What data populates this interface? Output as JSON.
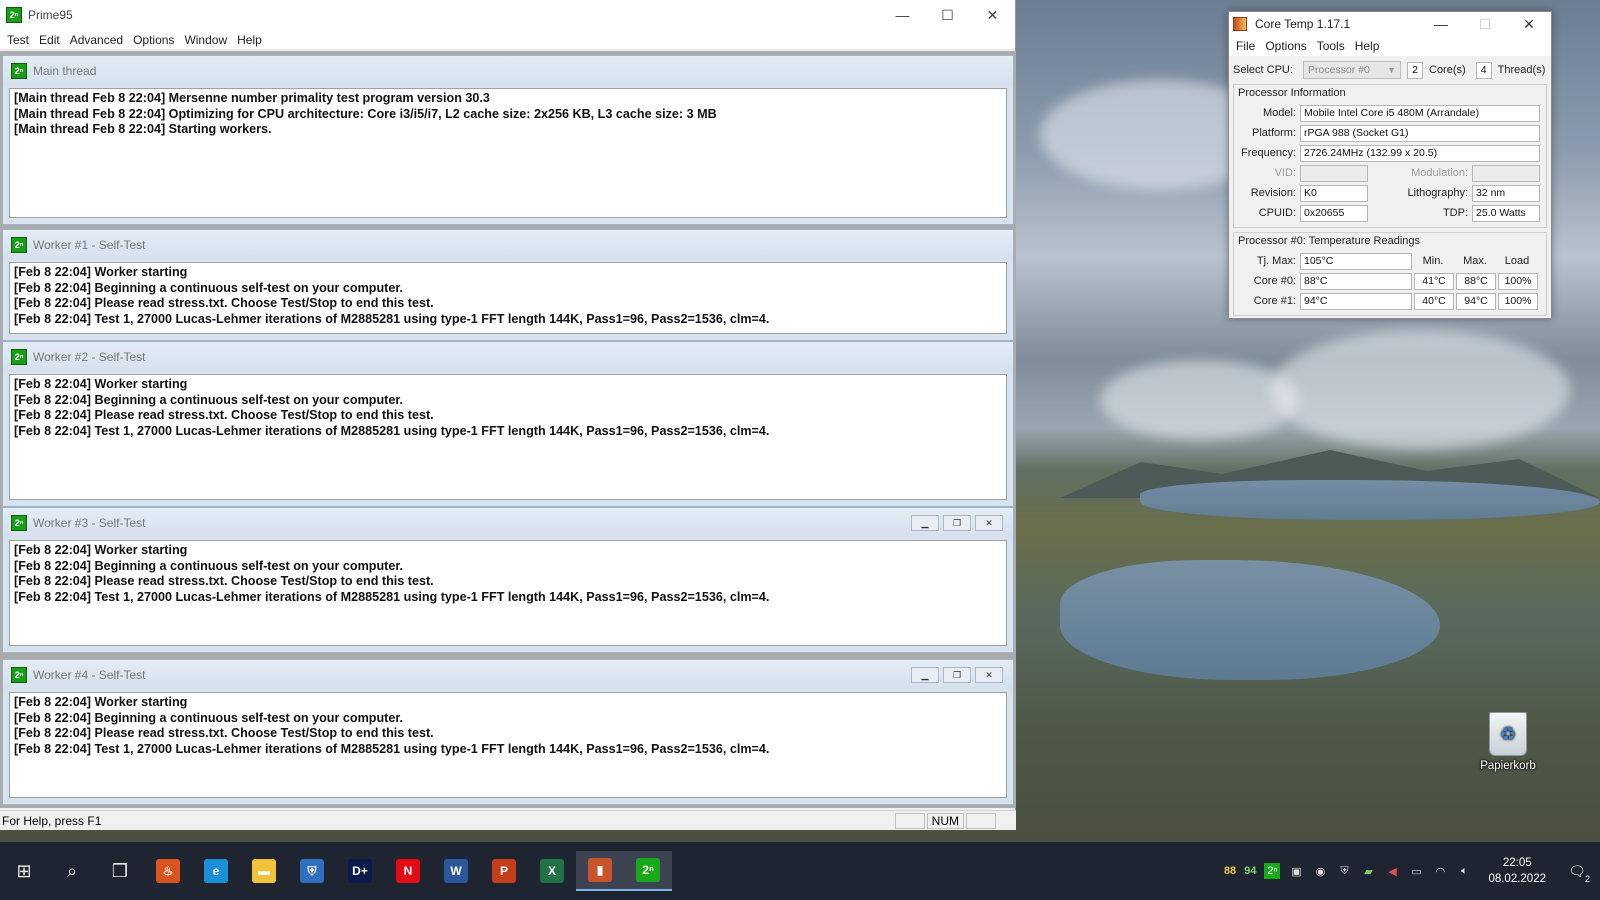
{
  "prime95": {
    "title": "Prime95",
    "menu": [
      "Test",
      "Edit",
      "Advanced",
      "Options",
      "Window",
      "Help"
    ],
    "windows": [
      {
        "title": "Main thread",
        "lines": [
          "[Main thread Feb 8 22:04] Mersenne number primality test program version 30.3",
          "[Main thread Feb 8 22:04] Optimizing for CPU architecture: Core i3/i5/i7, L2 cache size: 2x256 KB, L3 cache size: 3 MB",
          "[Main thread Feb 8 22:04] Starting workers."
        ]
      },
      {
        "title": "Worker #1 - Self-Test",
        "lines": [
          "[Feb 8 22:04] Worker starting",
          "[Feb 8 22:04] Beginning a continuous self-test on your computer.",
          "[Feb 8 22:04] Please read stress.txt.  Choose Test/Stop to end this test.",
          "[Feb 8 22:04] Test 1, 27000 Lucas-Lehmer iterations of M2885281 using type-1 FFT length 144K, Pass1=96, Pass2=1536, clm=4."
        ]
      },
      {
        "title": "Worker #2 - Self-Test",
        "lines": [
          "[Feb 8 22:04] Worker starting",
          "[Feb 8 22:04] Beginning a continuous self-test on your computer.",
          "[Feb 8 22:04] Please read stress.txt.  Choose Test/Stop to end this test.",
          "[Feb 8 22:04] Test 1, 27000 Lucas-Lehmer iterations of M2885281 using type-1 FFT length 144K, Pass1=96, Pass2=1536, clm=4."
        ]
      },
      {
        "title": "Worker #3 - Self-Test",
        "lines": [
          "[Feb 8 22:04] Worker starting",
          "[Feb 8 22:04] Beginning a continuous self-test on your computer.",
          "[Feb 8 22:04] Please read stress.txt.  Choose Test/Stop to end this test.",
          "[Feb 8 22:04] Test 1, 27000 Lucas-Lehmer iterations of M2885281 using type-1 FFT length 144K, Pass1=96, Pass2=1536, clm=4."
        ]
      },
      {
        "title": "Worker #4 - Self-Test",
        "lines": [
          "[Feb 8 22:04] Worker starting",
          "[Feb 8 22:04] Beginning a continuous self-test on your computer.",
          "[Feb 8 22:04] Please read stress.txt.  Choose Test/Stop to end this test.",
          "[Feb 8 22:04] Test 1, 27000 Lucas-Lehmer iterations of M2885281 using type-1 FFT length 144K, Pass1=96, Pass2=1536, clm=4."
        ]
      }
    ],
    "status": {
      "help_text": "For Help, press F1",
      "num": "NUM"
    }
  },
  "coretemp": {
    "title": "Core Temp 1.17.1",
    "menu": [
      "File",
      "Options",
      "Tools",
      "Help"
    ],
    "select_cpu_label": "Select CPU:",
    "processor_select": "Processor #0",
    "cores_value": "2",
    "cores_label": "Core(s)",
    "threads_value": "4",
    "threads_label": "Thread(s)",
    "info_group_title": "Processor Information",
    "model_label": "Model:",
    "model": "Mobile Intel Core i5 480M (Arrandale)",
    "platform_label": "Platform:",
    "platform": "rPGA 988 (Socket G1)",
    "frequency_label": "Frequency:",
    "frequency": "2726.24MHz (132.99 x 20.5)",
    "vid_label": "VID:",
    "modulation_label": "Modulation:",
    "revision_label": "Revision:",
    "revision": "K0",
    "lithography_label": "Lithography:",
    "lithography": "32 nm",
    "cpuid_label": "CPUID:",
    "cpuid": "0x20655",
    "tdp_label": "TDP:",
    "tdp": "25.0 Watts",
    "temps_group_title": "Processor #0: Temperature Readings",
    "tjmax_label": "Tj. Max:",
    "tjmax": "105°C",
    "col_min": "Min.",
    "col_max": "Max.",
    "col_load": "Load",
    "cores": [
      {
        "label": "Core #0:",
        "temp": "88°C",
        "min": "41°C",
        "max": "88°C",
        "load": "100%"
      },
      {
        "label": "Core #1:",
        "temp": "94°C",
        "min": "40°C",
        "max": "94°C",
        "load": "100%"
      }
    ]
  },
  "desktop": {
    "recycle_bin_label": "Papierkorb"
  },
  "taskbar": {
    "tray_temps": [
      "88",
      "94"
    ],
    "time": "22:05",
    "date": "08.02.2022",
    "notification_count": "2",
    "apps": [
      {
        "name": "coretemp-flame",
        "color": "#d9531e"
      },
      {
        "name": "edge",
        "color": "#1b8fd6"
      },
      {
        "name": "explorer",
        "color": "#f2c23a"
      },
      {
        "name": "windows-security",
        "color": "#2f6fbf"
      },
      {
        "name": "disney-plus",
        "color": "#0b1a4d"
      },
      {
        "name": "netflix",
        "color": "#e50914"
      },
      {
        "name": "word",
        "color": "#2b579a"
      },
      {
        "name": "powerpoint",
        "color": "#c43e1c"
      },
      {
        "name": "excel",
        "color": "#217346"
      },
      {
        "name": "coretemp",
        "color": "#c8542c"
      },
      {
        "name": "prime95",
        "color": "#19a81a"
      }
    ]
  },
  "colors": {
    "accent_green": "#19a81a",
    "tray_temp_color": "#e8c84a"
  }
}
